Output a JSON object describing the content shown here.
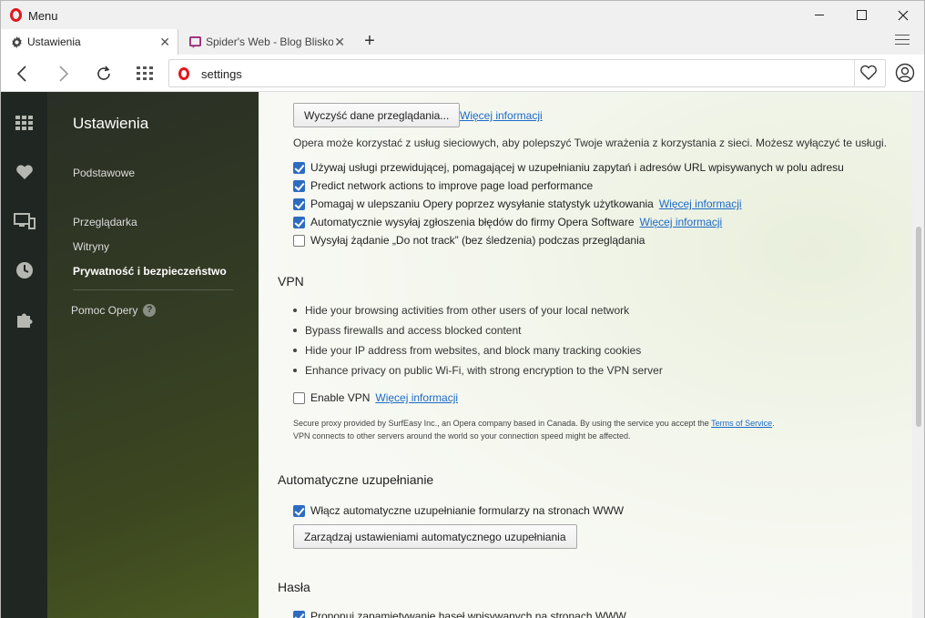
{
  "window": {
    "menu_label": "Menu"
  },
  "tabs": [
    {
      "label": "Ustawienia",
      "icon": "gear-icon"
    },
    {
      "label": "Spider's Web - Blog Blisko",
      "icon": "spider-web-favicon"
    }
  ],
  "address_bar": {
    "url": "settings"
  },
  "sidebar": {
    "title": "Ustawienia",
    "items": [
      {
        "label": "Podstawowe"
      },
      {
        "label": "Przeglądarka"
      },
      {
        "label": "Witryny"
      },
      {
        "label": "Prywatność i bezpieczeństwo"
      }
    ],
    "help_label": "Pomoc Opery"
  },
  "privacy": {
    "clear_button": "Wyczyść dane przeglądania...",
    "clear_more": "Więcej informacji",
    "services_note": "Opera może korzystać z usług sieciowych, aby polepszyć Twoje wrażenia z korzystania z sieci. Możesz wyłączyć te usługi.",
    "options": [
      {
        "label": "Używaj usługi przewidującej, pomagającej w uzupełnianiu zapytań i adresów URL wpisywanych w polu adresu",
        "checked": true,
        "link": ""
      },
      {
        "label": "Predict network actions to improve page load performance",
        "checked": true,
        "link": ""
      },
      {
        "label": "Pomagaj w ulepszaniu Opery poprzez wysyłanie statystyk użytkowania",
        "checked": true,
        "link": "Więcej informacji"
      },
      {
        "label": "Automatycznie wysyłaj zgłoszenia błędów do firmy Opera Software",
        "checked": true,
        "link": "Więcej informacji"
      },
      {
        "label": "Wysyłaj żądanie „Do not track” (bez śledzenia) podczas przeglądania",
        "checked": false,
        "link": ""
      }
    ]
  },
  "vpn": {
    "heading": "VPN",
    "bullets": [
      "Hide your browsing activities from other users of your local network",
      "Bypass firewalls and access blocked content",
      "Hide your IP address from websites, and block many tracking cookies",
      "Enhance privacy on public Wi-Fi, with strong encryption to the VPN server"
    ],
    "enable_label": "Enable VPN",
    "enable_checked": false,
    "enable_more": "Więcej informacji",
    "note_line1": "Secure proxy provided by SurfEasy Inc., an Opera company based in Canada. By using the service you accept the",
    "note_link": "Terms of Service",
    "note_line1_end": ".",
    "note_line2": "VPN connects to other servers around the world so your connection speed might be affected."
  },
  "autofill": {
    "heading": "Automatyczne uzupełnianie",
    "enable_label": "Włącz automatyczne uzupełnianie formularzy na stronach WWW",
    "enable_checked": true,
    "manage_button": "Zarządzaj ustawieniami automatycznego uzupełniania"
  },
  "passwords": {
    "heading": "Hasła",
    "offer_label": "Proponuj zapamiętywanie haseł wpisywanych na stronach WWW",
    "offer_checked": true
  },
  "colors": {
    "accent": "#2d6cc0",
    "link": "#1b6ac9",
    "opera_red": "#e0171e",
    "sidebar_dark": "#202622"
  }
}
